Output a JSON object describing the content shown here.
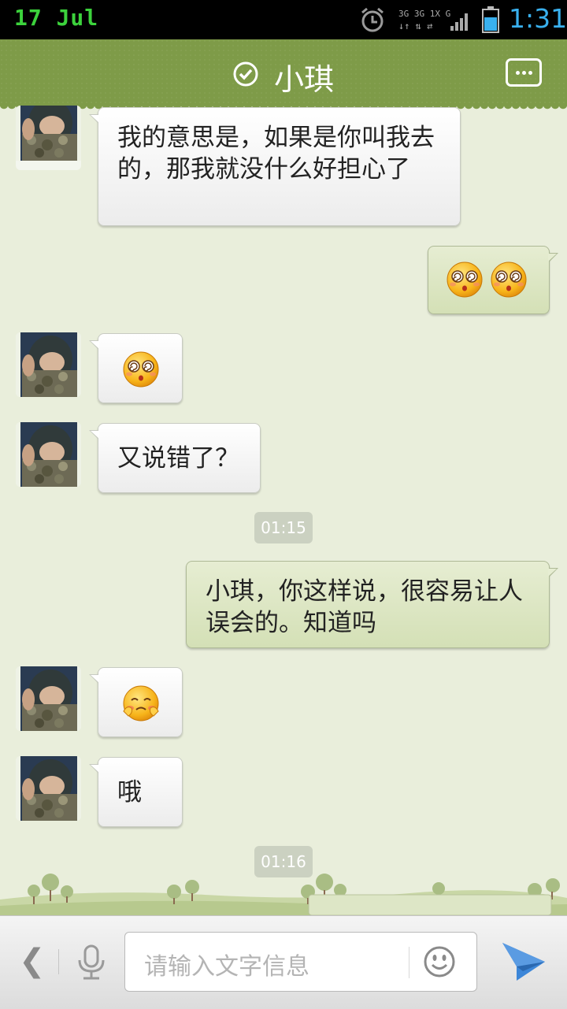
{
  "status_bar": {
    "date": "17  Jul",
    "time": "1:31",
    "network_labels": [
      "3G",
      "3G",
      "1X",
      "G"
    ]
  },
  "header": {
    "contact_name": "小琪"
  },
  "messages": [
    {
      "from": "them",
      "text": "我的意思是，如果是你叫我去的，那我就没什么好担心了"
    },
    {
      "from": "me",
      "emoji": [
        "dizzy-face-emoji",
        "dizzy-face-emoji"
      ]
    },
    {
      "from": "them",
      "emoji": [
        "dizzy-face-emoji"
      ]
    },
    {
      "from": "them",
      "text": "又说错了？"
    },
    {
      "type": "timestamp",
      "text": "01:15"
    },
    {
      "from": "me",
      "text": "小琪，你这样说，很容易让人误会的。知道吗"
    },
    {
      "from": "them",
      "emoji": [
        "shy-face-emoji"
      ]
    },
    {
      "from": "them",
      "text": "哦"
    },
    {
      "type": "timestamp",
      "text": "01:16"
    }
  ],
  "input_bar": {
    "placeholder": "请输入文字信息"
  },
  "colors": {
    "header_bg": "#7e9b48",
    "chat_bg": "#e9eedb",
    "outgoing_bubble": "#d4e0b6",
    "incoming_bubble": "#ffffff",
    "time_accent": "#39b0ee",
    "date_accent": "#3cd23c"
  }
}
